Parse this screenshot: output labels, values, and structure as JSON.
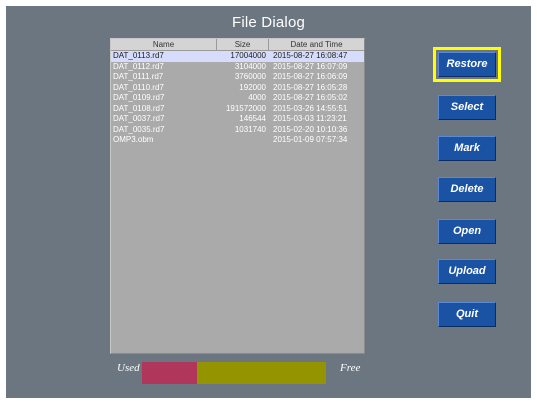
{
  "window": {
    "title": "File Dialog"
  },
  "table": {
    "columns": [
      "Name",
      "Size",
      "Date and Time"
    ],
    "selected_index": 0,
    "rows": [
      {
        "name": "DAT_0113.rd7",
        "size": "17004000",
        "date": "2015-08-27 16:08:47"
      },
      {
        "name": "DAT_0112.rd7",
        "size": "3104000",
        "date": "2015-08-27 16:07:09"
      },
      {
        "name": "DAT_0111.rd7",
        "size": "3760000",
        "date": "2015-08-27 16:06:09"
      },
      {
        "name": "DAT_0110.rd7",
        "size": "192000",
        "date": "2015-08-27 16:05:28"
      },
      {
        "name": "DAT_0109.rd7",
        "size": "4000",
        "date": "2015-08-27 16:05:02"
      },
      {
        "name": "DAT_0108.rd7",
        "size": "191572000",
        "date": "2015-03-26 14:55:51"
      },
      {
        "name": "DAT_0037.rd7",
        "size": "146544",
        "date": "2015-03-03 11:23:21"
      },
      {
        "name": "DAT_0035.rd7",
        "size": "1031740",
        "date": "2015-02-20 10:10:36"
      },
      {
        "name": "OMP3.obm",
        "size": "",
        "date": "2015-01-09 07:57:34"
      }
    ]
  },
  "buttons": {
    "restore": "Restore",
    "select": "Select",
    "mark": "Mark",
    "delete": "Delete",
    "open": "Open",
    "upload": "Upload",
    "quit": "Quit",
    "focused": "restore"
  },
  "storage": {
    "used_label": "Used",
    "free_label": "Free",
    "used_fraction": 0.3,
    "used_color": "#b0365c",
    "free_color": "#949400"
  },
  "colors": {
    "background": "#6c7680",
    "button": "#1a52a4",
    "focus_outline": "#ffff00",
    "selected_row": "#d6dcfb"
  }
}
